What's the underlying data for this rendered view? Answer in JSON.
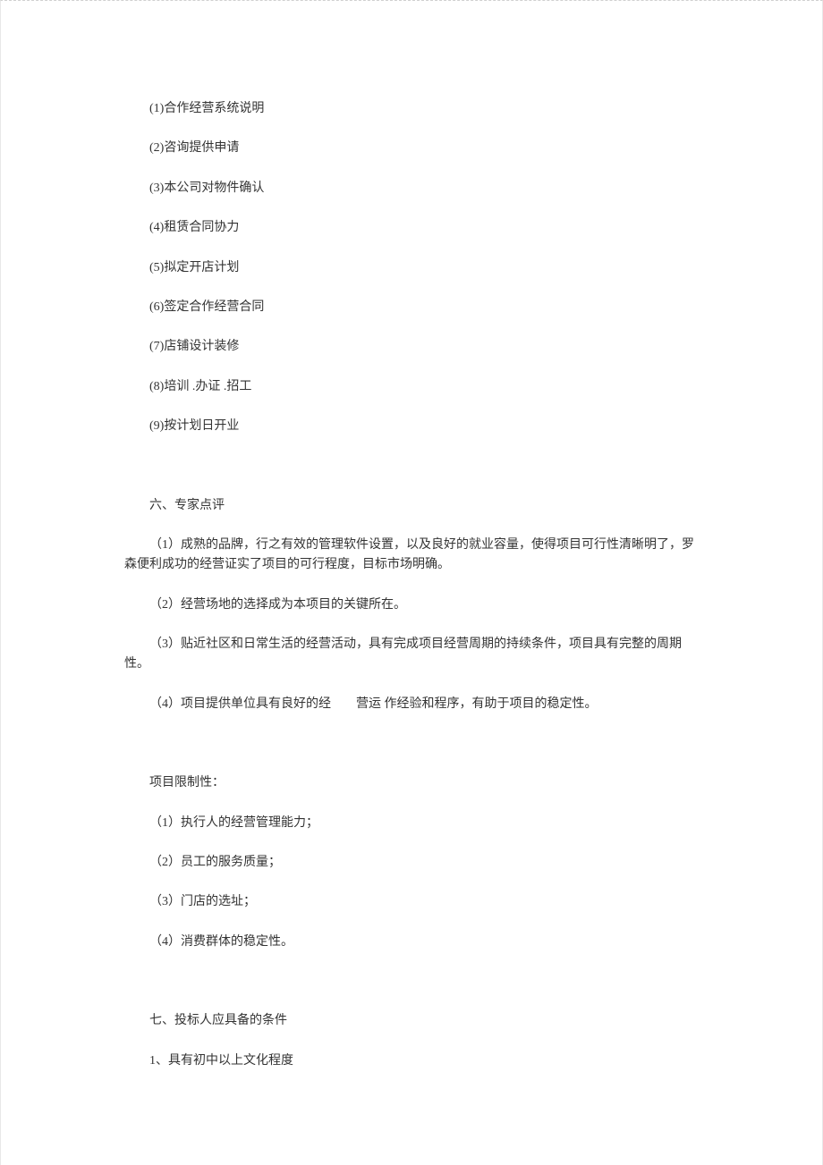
{
  "section5": {
    "items": [
      "(1)合作经营系统说明",
      "(2)咨询提供申请",
      "(3)本公司对物件确认",
      "(4)租赁合同协力",
      "(5)拟定开店计划",
      "(6)签定合作经营合同",
      "(7)店铺设计装修",
      "(8)培训 .办证 .招工",
      "(9)按计划日开业"
    ]
  },
  "section6": {
    "heading": "六、专家点评",
    "p1": "（1）成熟的品牌，行之有效的管理软件设置，以及良好的就业容量，使得项目可行性清晰明了，罗森便利成功的经营证实了项目的可行程度，目标市场明确。",
    "p2": "（2）经营场地的选择成为本项目的关键所在。",
    "p3": "（3）贴近社区和日常生活的经营活动，具有完成项目经营周期的持续条件，项目具有完整的周期性。",
    "p4_a": "（4）项目提供单位具有良好的经",
    "p4_b": "营运 作经验和程序，有助于项目的稳定性。",
    "limits_heading": "项目限制性：",
    "limits": [
      "（1）执行人的经营管理能力；",
      "（2）员工的服务质量；",
      "（3）门店的选址；",
      "（4）消费群体的稳定性。"
    ]
  },
  "section7": {
    "heading": "七、投标人应具备的条件",
    "item1": "1、具有初中以上文化程度"
  }
}
